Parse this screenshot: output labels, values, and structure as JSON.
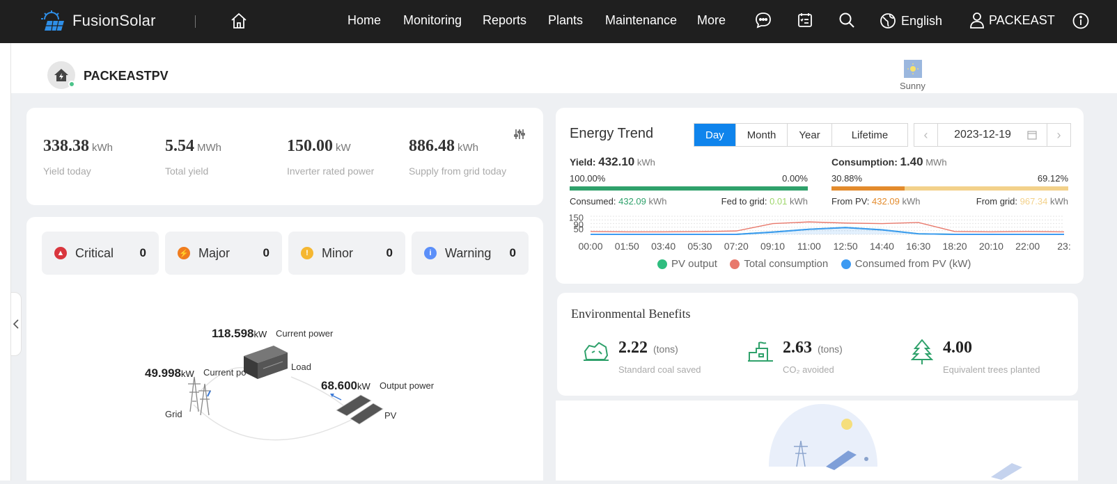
{
  "topbar": {
    "brand": "FusionSolar",
    "nav": [
      "Home",
      "Monitoring",
      "Reports",
      "Plants",
      "Maintenance",
      "More"
    ],
    "language": "English",
    "user": "PACKEAST"
  },
  "plant": {
    "name": "PACKEASTPV",
    "weather": "Sunny"
  },
  "kpis": [
    {
      "value": "338.38",
      "unit": "kWh",
      "label": "Yield today"
    },
    {
      "value": "5.54",
      "unit": "MWh",
      "label": "Total yield"
    },
    {
      "value": "150.00",
      "unit": "kW",
      "label": "Inverter rated power"
    },
    {
      "value": "886.48",
      "unit": "kWh",
      "label": "Supply from grid today"
    }
  ],
  "alarms": [
    {
      "label": "Critical",
      "count": "0",
      "color": "#d9363e",
      "glyph": "!"
    },
    {
      "label": "Major",
      "count": "0",
      "color": "#f07c1e",
      "glyph": "⚡"
    },
    {
      "label": "Minor",
      "count": "0",
      "color": "#f5b731",
      "glyph": "!"
    },
    {
      "label": "Warning",
      "count": "0",
      "color": "#5b8ff9",
      "glyph": "i"
    }
  ],
  "flow": {
    "load_value": "118.598",
    "load_unit": "kW",
    "load_caption": "Current power",
    "load_label": "Load",
    "grid_value": "49.998",
    "grid_unit": "kW",
    "grid_caption": "Current po",
    "grid_label": "Grid",
    "pv_value": "68.600",
    "pv_unit": "kW",
    "pv_caption": "Output power",
    "pv_label": "PV"
  },
  "energy_trend": {
    "title": "Energy Trend",
    "tabs": [
      "Day",
      "Month",
      "Year",
      "Lifetime"
    ],
    "active_tab": "Day",
    "date": "2023-12-19",
    "yield": {
      "label": "Yield:",
      "value": "432.10",
      "unit": "kWh",
      "left_pct_text": "100.00%",
      "right_pct_text": "0.00%",
      "left_fraction": 1.0,
      "consumed_label": "Consumed:",
      "consumed_value": "432.09",
      "consumed_unit": "kWh",
      "fed_label": "Fed to grid:",
      "fed_value": "0.01",
      "fed_unit": "kWh"
    },
    "consumption": {
      "label": "Consumption:",
      "value": "1.40",
      "unit": "MWh",
      "left_pct_text": "30.88%",
      "right_pct_text": "69.12%",
      "left_fraction": 0.3088,
      "pv_label": "From PV:",
      "pv_value": "432.09",
      "pv_unit": "kWh",
      "grid_label": "From grid:",
      "grid_value": "967.34",
      "grid_unit": "kWh"
    },
    "colors": {
      "pv": "#2fa16b",
      "consumption": "#e8786b",
      "from_pv": "#3c9af2",
      "orange": "#e38b2c",
      "lightorange": "#f3d18a"
    }
  },
  "chart_data": {
    "type": "line",
    "y_tick_labels": [
      "150",
      "90",
      "50"
    ],
    "ylim": [
      0,
      160
    ],
    "x": [
      "00:00",
      "01:50",
      "03:40",
      "05:30",
      "07:20",
      "09:10",
      "11:00",
      "12:50",
      "14:40",
      "16:30",
      "18:20",
      "20:10",
      "22:00",
      "23:"
    ],
    "series": [
      {
        "name": "PV output",
        "color": "#2fbd7f",
        "values": [
          0,
          0,
          0,
          0,
          0,
          20,
          45,
          60,
          40,
          5,
          0,
          0,
          0,
          0
        ]
      },
      {
        "name": "Total consumption",
        "color": "#e8786b",
        "values": [
          25,
          22,
          22,
          24,
          30,
          95,
          110,
          100,
          95,
          105,
          25,
          22,
          25,
          22
        ]
      },
      {
        "name": "Consumed from PV (kW)",
        "color": "#3c9af2",
        "values": [
          0,
          0,
          0,
          0,
          0,
          20,
          45,
          60,
          40,
          5,
          0,
          0,
          0,
          0
        ]
      }
    ]
  },
  "environment": {
    "title": "Environmental Benefits",
    "items": [
      {
        "value": "2.22",
        "unit": "(tons)",
        "label": "Standard coal saved",
        "icon": "coal-icon"
      },
      {
        "value": "2.63",
        "unit": "(tons)",
        "label": "CO₂ avoided",
        "icon": "factory-icon"
      },
      {
        "value": "4.00",
        "unit": "",
        "label": "Equivalent trees planted",
        "icon": "tree-icon"
      }
    ]
  }
}
